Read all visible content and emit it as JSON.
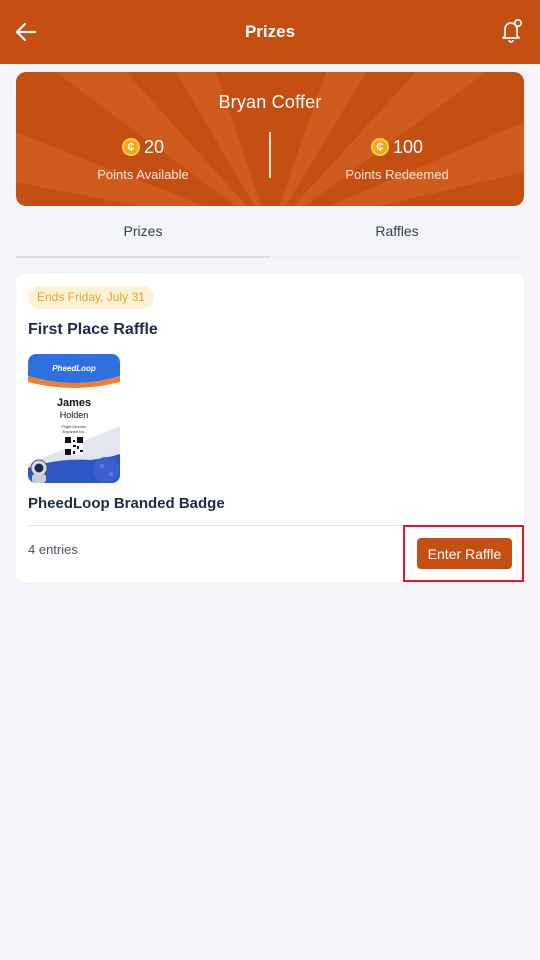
{
  "header": {
    "title": "Prizes",
    "back_icon": "arrow-left-icon",
    "notify_icon": "bell-icon"
  },
  "profile": {
    "name": "Bryan Coffer",
    "points_available": "20",
    "points_available_label": "Points Available",
    "points_redeemed": "100",
    "points_redeemed_label": "Points Redeemed",
    "coin_icon": "coin-icon"
  },
  "tabs": [
    {
      "label": "Prizes",
      "active": true
    },
    {
      "label": "Raffles",
      "active": false
    }
  ],
  "raffle": {
    "ends_label": "Ends Friday, July 31",
    "title": "First Place Raffle",
    "prize_name": "PheedLoop Branded Badge",
    "entries": "4 entries",
    "enter_label": "Enter Raffle",
    "badge": {
      "brand": "PheedLoop",
      "first_name": "James",
      "last_name": "Holden",
      "role": "Flight Director",
      "company": "Expanse Inc."
    }
  },
  "colors": {
    "brand": "#c54f12",
    "chip_bg": "#fdf2d6",
    "chip_text": "#e0a524",
    "highlight": "#e5132b"
  }
}
